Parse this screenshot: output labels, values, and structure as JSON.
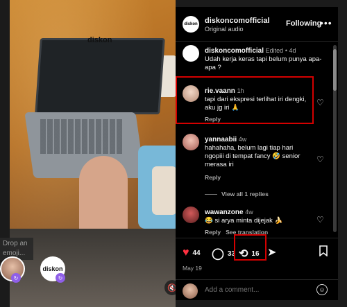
{
  "header": {
    "username": "diskoncomofficial",
    "subtitle": "Original audio",
    "follow_label": "Following",
    "more_icon": "more-icon",
    "avatar_text": "diskon"
  },
  "media": {
    "brand_tag": "diskon",
    "drop_emoji": "Drop an emoji...",
    "bubble_b_text": "diskon"
  },
  "caption": {
    "username": "diskoncomofficial",
    "edited": "Edited",
    "time": "4d",
    "text": "Udah kerja keras tapi belum punya apa-apa ?"
  },
  "comments": [
    {
      "username": "rie.vaann",
      "time": "1h",
      "text": "tapi dari ekspresi terlihat iri dengki, aku jg iri 🙏",
      "reply": "Reply"
    },
    {
      "username": "yannaabii",
      "time": "4w",
      "text": "hahahaha, belum lagi tiap hari ngopiii di tempat fancy 🤣 senior merasa iri",
      "reply": "Reply",
      "view_replies": "View all 1 replies"
    },
    {
      "username": "wawanzone",
      "time": "4w",
      "text": "😂 si arya minta dijejak 🍌",
      "reply": "Reply",
      "see_translation": "See translation"
    }
  ],
  "actions": {
    "likes": "44",
    "comments": "33",
    "reposts": "16",
    "date": "May 19"
  },
  "add_comment": {
    "placeholder": "Add a comment..."
  },
  "colors": {
    "like": "#ff3040",
    "highlight": "#d40000",
    "badge": "#8f5fe8"
  }
}
